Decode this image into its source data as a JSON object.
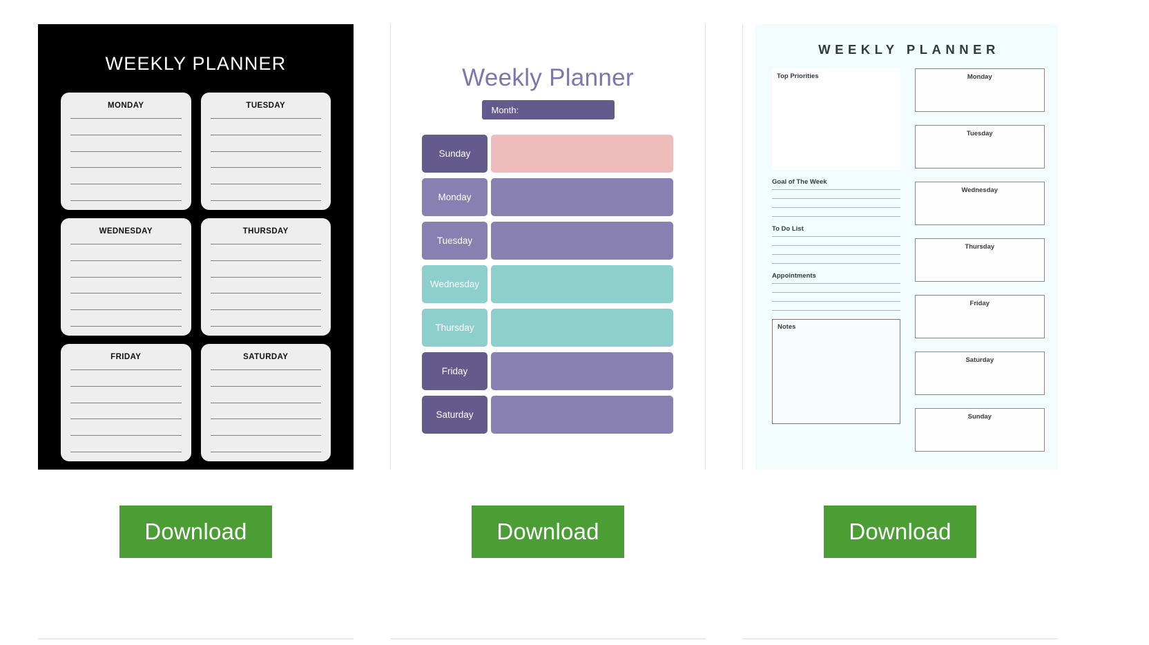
{
  "planners": [
    {
      "id": "black-weekly-planner",
      "title": "WEEKLY PLANNER",
      "theme": {
        "background": "#000000",
        "card": "#eeeeee",
        "rule": "#808080"
      },
      "days": [
        "MONDAY",
        "TUESDAY",
        "WEDNESDAY",
        "THURSDAY",
        "FRIDAY",
        "SATURDAY"
      ],
      "lines_per_card": 6,
      "download_label": "Download"
    },
    {
      "id": "purple-weekly-planner",
      "title": "Weekly Planner",
      "month_label": "Month:",
      "theme": {
        "title": "#7d76ab",
        "month_bar": "#645b8c",
        "dark_purple": "#645b8c",
        "light_purple": "#8780b0",
        "teal": "#8ccfcd",
        "pink": "#edbcbb"
      },
      "rows": [
        {
          "day": "Sunday",
          "label_color": "#645b8c",
          "field_color": "#edbcbb"
        },
        {
          "day": "Monday",
          "label_color": "#8780b0",
          "field_color": "#8780b0"
        },
        {
          "day": "Tuesday",
          "label_color": "#8780b0",
          "field_color": "#8780b0"
        },
        {
          "day": "Wednesday",
          "label_color": "#8ccfcd",
          "field_color": "#8ccfcd"
        },
        {
          "day": "Thursday",
          "label_color": "#8ccfcd",
          "field_color": "#8ccfcd"
        },
        {
          "day": "Friday",
          "label_color": "#645b8c",
          "field_color": "#8780b0"
        },
        {
          "day": "Saturday",
          "label_color": "#645b8c",
          "field_color": "#8780b0"
        }
      ],
      "download_label": "Download"
    },
    {
      "id": "cyan-weekly-planner",
      "title": "WEEKLY PLANNER",
      "theme": {
        "panel": "#f2fcfd",
        "box_border": "#9a7e80",
        "rule": "#a9b7bd",
        "text": "#33393f"
      },
      "sections": [
        {
          "name": "Top Priorities",
          "type": "box",
          "lines": 0
        },
        {
          "name": "Goal of The Week",
          "type": "lines",
          "lines": 4
        },
        {
          "name": "To Do List",
          "type": "lines",
          "lines": 4
        },
        {
          "name": "Appointments",
          "type": "lines",
          "lines": 4
        },
        {
          "name": "Notes",
          "type": "box",
          "lines": 0
        }
      ],
      "days": [
        "Monday",
        "Tuesday",
        "Wednesday",
        "Thursday",
        "Friday",
        "Saturday",
        "Sunday"
      ],
      "download_label": "Download"
    }
  ],
  "download_button": {
    "label": "Download",
    "color": "#4a9e34"
  }
}
